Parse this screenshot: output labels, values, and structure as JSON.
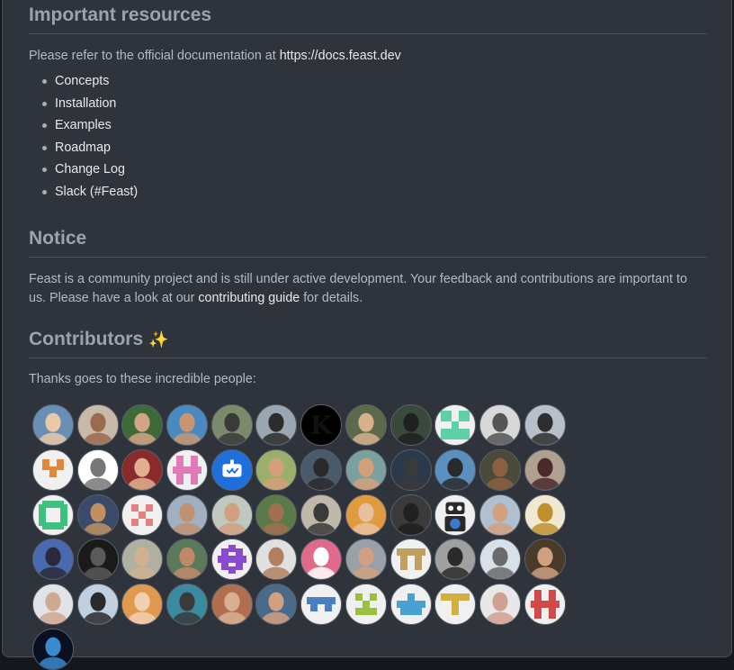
{
  "sections": {
    "resources": {
      "title": "Important resources",
      "intro": "Please refer to the official documentation at ",
      "doc_link": "https://docs.feast.dev",
      "items": [
        "Concepts",
        "Installation",
        "Examples",
        "Roadmap",
        "Change Log",
        "Slack (#Feast)"
      ]
    },
    "notice": {
      "title": "Notice",
      "text_before": "Feast is a community project and is still under active development. Your feedback and contributions are important to us. Please have a look at our ",
      "link": "contributing guide",
      "text_after": " for details."
    },
    "contributors": {
      "title": "Contributors",
      "sparkle": "✨",
      "intro": "Thanks goes to these incredible people:"
    }
  },
  "colors": {
    "background": "#2e333c",
    "heading": "#9ca3ad",
    "link": "#e6e9ee",
    "text": "#b4bac2"
  },
  "avatars": [
    {
      "type": "photo",
      "bg": "#6a8fb5",
      "fg": "#e8c9a8"
    },
    {
      "type": "photo",
      "bg": "#c9b9a8",
      "fg": "#9a6b4f"
    },
    {
      "type": "photo",
      "bg": "#3e6a3a",
      "fg": "#d2a684"
    },
    {
      "type": "photo",
      "bg": "#4a8ac0",
      "fg": "#c9946f"
    },
    {
      "type": "photo",
      "bg": "#7a8a6a",
      "fg": "#3a3a3a"
    },
    {
      "type": "photo",
      "bg": "#9aa7b3",
      "fg": "#2c2c2c"
    },
    {
      "type": "letter",
      "bg": "#ffffff",
      "fg": "#111111",
      "letter": "K"
    },
    {
      "type": "photo",
      "bg": "#5a6a4a",
      "fg": "#d8b08c"
    },
    {
      "type": "photo",
      "bg": "#3a4a3a",
      "fg": "#202020"
    },
    {
      "type": "identicon",
      "bg": "#f0f0f0",
      "fg": "#5ecfa8",
      "pattern": "M0,0h3v3h-3zM5,0h3v3h-3zM0,5h8v3h-8zM3,3h2v2h-2z"
    },
    {
      "type": "photo",
      "bg": "#d8d8d8",
      "fg": "#555555"
    },
    {
      "type": "photo",
      "bg": "#b5c0c8",
      "fg": "#2e2e2e"
    },
    {
      "type": "identicon",
      "bg": "#f0f0f0",
      "fg": "#e0883a",
      "pattern": "M1,1h2v3h-2zM5,1h2v3h-2zM3,3h2v3h-2z"
    },
    {
      "type": "photo",
      "bg": "#ffffff",
      "fg": "#777777"
    },
    {
      "type": "photo",
      "bg": "#8a2a2a",
      "fg": "#e0b090"
    },
    {
      "type": "identicon",
      "bg": "#f0f0f0",
      "fg": "#e07ab8",
      "pattern": "M1,0h2v3h-2zM5,0h2v3h-2zM0,3h8v2h-8zM1,5h2v3h-2zM5,5h2v3h-2z"
    },
    {
      "type": "bot",
      "bg": "#1e6fd9",
      "fg": "#ffffff"
    },
    {
      "type": "photo",
      "bg": "#9ab06a",
      "fg": "#d4a07a"
    },
    {
      "type": "photo",
      "bg": "#4a5a6a",
      "fg": "#2a2a2a"
    },
    {
      "type": "photo",
      "bg": "#7aa0a0",
      "fg": "#d4a07a"
    },
    {
      "type": "photo",
      "bg": "#2a3a4a",
      "fg": "#3a3a3a"
    },
    {
      "type": "photo",
      "bg": "#5a90c0",
      "fg": "#2a2a2a"
    },
    {
      "type": "photo",
      "bg": "#4a4a3a",
      "fg": "#8a6040"
    },
    {
      "type": "photo",
      "bg": "#b0a090",
      "fg": "#4a2a2a"
    },
    {
      "type": "identicon",
      "bg": "#f0f0f0",
      "fg": "#3ec080",
      "pattern": "M1,0h6v2h-6zM0,1h2v6h-2zM6,1h2v6h-2zM1,6h6v2h-6z"
    },
    {
      "type": "photo",
      "bg": "#3a4a6a",
      "fg": "#c09060"
    },
    {
      "type": "identicon",
      "bg": "#f0f0f0",
      "fg": "#e08080",
      "pattern": "M1,1h2v2h-2zM5,1h2v2h-2zM3,3h2v2h-2zM1,5h2v2h-2zM5,5h2v2h-2z"
    },
    {
      "type": "photo",
      "bg": "#a0b0c0",
      "fg": "#c09070"
    },
    {
      "type": "photo",
      "bg": "#c0c8c0",
      "fg": "#d0a080"
    },
    {
      "type": "photo",
      "bg": "#5a7a4a",
      "fg": "#a07050"
    },
    {
      "type": "photo",
      "bg": "#c0b8a8",
      "fg": "#3a3a3a"
    },
    {
      "type": "photo",
      "bg": "#e09a40",
      "fg": "#e8c0a0"
    },
    {
      "type": "photo",
      "bg": "#3a3a3a",
      "fg": "#202020"
    },
    {
      "type": "robot",
      "bg": "#f0f0f0",
      "fg": "#2a2a2a"
    },
    {
      "type": "photo",
      "bg": "#b0c0d0",
      "fg": "#d0a080"
    },
    {
      "type": "photo",
      "bg": "#f0e8d0",
      "fg": "#c09030"
    },
    {
      "type": "photo",
      "bg": "#4a6ab0",
      "fg": "#2a2a3a"
    },
    {
      "type": "photo",
      "bg": "#1a1a1a",
      "fg": "#5a5a5a"
    },
    {
      "type": "photo",
      "bg": "#b0b0a0",
      "fg": "#d0b090"
    },
    {
      "type": "photo",
      "bg": "#5a7a5a",
      "fg": "#c08a6a"
    },
    {
      "type": "identicon",
      "bg": "#f0f0f0",
      "fg": "#8a4ad0",
      "pattern": "M1,1h2v6h-2zM5,1h2v6h-2zM0,3h8v2h-8zM3,0h2v2h-2zM3,6h2v2h-2z"
    },
    {
      "type": "photo",
      "bg": "#e0e0e0",
      "fg": "#b08060"
    },
    {
      "type": "photo",
      "bg": "#e06a8a",
      "fg": "#ffffff"
    },
    {
      "type": "photo",
      "bg": "#9aa0a8",
      "fg": "#d0a080"
    },
    {
      "type": "identicon",
      "bg": "#f0f0f0",
      "fg": "#c0a060",
      "pattern": "M0,1h8v2h-8zM1,3h2v4h-2zM5,3h2v4h-2z"
    },
    {
      "type": "photo",
      "bg": "#a0a0a0",
      "fg": "#2a2a2a"
    },
    {
      "type": "photo",
      "bg": "#d8e0e8",
      "fg": "#6a6a6a"
    },
    {
      "type": "photo",
      "bg": "#4a3a2a",
      "fg": "#d0a080"
    },
    {
      "type": "photo",
      "bg": "#e0e4e8",
      "fg": "#d0a890"
    },
    {
      "type": "photo",
      "bg": "#c0d0e0",
      "fg": "#2a2a2a"
    },
    {
      "type": "photo",
      "bg": "#e09a50",
      "fg": "#f0d0b0"
    },
    {
      "type": "photo",
      "bg": "#3a8aa0",
      "fg": "#3a3a3a"
    },
    {
      "type": "photo",
      "bg": "#b07050",
      "fg": "#d8b090"
    },
    {
      "type": "photo",
      "bg": "#4a6a8a",
      "fg": "#d0a080"
    },
    {
      "type": "identicon",
      "bg": "#f0f0f0",
      "fg": "#4a80c0",
      "pattern": "M0,2h8v2h-8zM1,4h2v2h-2zM5,4h2v2h-2z"
    },
    {
      "type": "identicon",
      "bg": "#f0f0f0",
      "fg": "#9ac040",
      "pattern": "M1,1h2v2h-2zM5,1h2v2h-2zM3,3h2v4h-2zM1,5h2v2h-2zM5,5h2v2h-2z"
    },
    {
      "type": "identicon",
      "bg": "#f0f0f0",
      "fg": "#4aa0d0",
      "pattern": "M3,1h2v2h-2zM0,3h8v2h-8zM1,5h6v2h-6z"
    },
    {
      "type": "identicon",
      "bg": "#f0f0f0",
      "fg": "#d0b040",
      "pattern": "M0,1h8v2h-8zM3,3h2v4h-2z"
    },
    {
      "type": "photo",
      "bg": "#e8e8e8",
      "fg": "#d0a090"
    },
    {
      "type": "identicon",
      "bg": "#f0f0f0",
      "fg": "#d04a4a",
      "pattern": "M1,0h2v3h-2zM5,0h2v3h-2zM0,3h8v2h-8zM1,5h2v3h-2zM5,5h2v3h-2z"
    },
    {
      "type": "photo",
      "bg": "#0a1020",
      "fg": "#3a8ad0"
    }
  ]
}
